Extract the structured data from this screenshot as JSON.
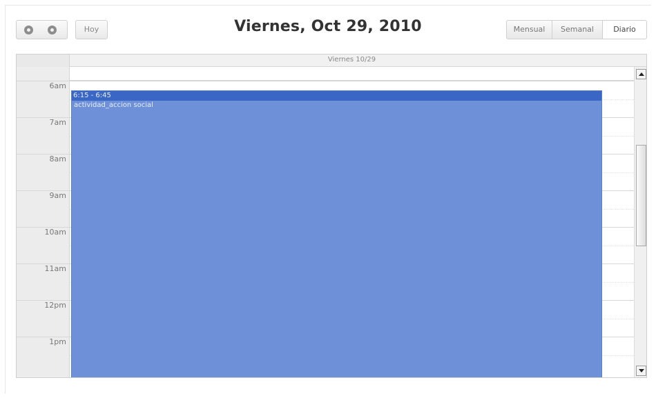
{
  "toolbar": {
    "today_label": "Hoy",
    "title": "Viernes, Oct 29, 2010",
    "views": [
      {
        "label": "Mensual",
        "active": false
      },
      {
        "label": "Semanal",
        "active": false
      },
      {
        "label": "Diario",
        "active": true
      }
    ]
  },
  "calendar": {
    "day_header": "Viernes 10/29",
    "hours": [
      "6am",
      "7am",
      "8am",
      "9am",
      "10am",
      "11am",
      "12pm",
      "1pm"
    ],
    "event": {
      "time": "6:15 - 6:45",
      "title": "actividad_accion social",
      "color": "#6d90d9",
      "header_color": "#3a66c6"
    }
  },
  "icons": {
    "prev": "prev-arrow-icon",
    "next": "next-arrow-icon",
    "scroll_up": "scroll-up-arrow-icon",
    "scroll_down": "scroll-down-arrow-icon"
  }
}
